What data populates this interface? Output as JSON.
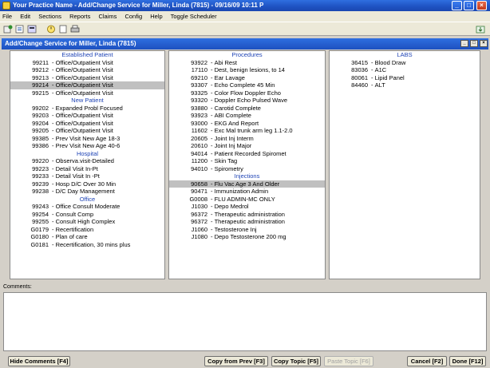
{
  "window": {
    "title": "Your Practice Name -  Add/Change Service for Miller, Linda (7815) - 09/16/09 10:11 P"
  },
  "menu": [
    "File",
    "Edit",
    "Sections",
    "Reports",
    "Claims",
    "Config",
    "Help",
    "Toggle Scheduler"
  ],
  "dialog": {
    "title": "Add/Change Service for Miller, Linda (7815)"
  },
  "left_panel": {
    "sections": [
      {
        "heading": "Established Patient",
        "items": [
          {
            "code": "99211",
            "desc": "Office/Outpatient Visit"
          },
          {
            "code": "99212",
            "desc": "Office/Outpatient Visit"
          },
          {
            "code": "99213",
            "desc": "Office/Outpatient Visit"
          },
          {
            "code": "99214",
            "desc": "Office/Outpatient Visit",
            "selected": true
          },
          {
            "code": "99215",
            "desc": "Office/Outpatient Visit"
          }
        ]
      },
      {
        "heading": "New Patient",
        "items": [
          {
            "code": "99202",
            "desc": "Expanded Probl Focused"
          },
          {
            "code": "99203",
            "desc": "Office/Outpatient Visit"
          },
          {
            "code": "99204",
            "desc": "Office/Outpatient Visit"
          },
          {
            "code": "99205",
            "desc": "Office/Outpatient Visit"
          },
          {
            "code": "99385",
            "desc": "Prev Visit New Age 18-3"
          },
          {
            "code": "99386",
            "desc": "Prev Visit New Age 40-6"
          }
        ]
      },
      {
        "heading": "Hospital",
        "items": [
          {
            "code": "99220",
            "desc": "Observa.visit-Detailed"
          },
          {
            "code": "99223",
            "desc": "Detail Visit In-Pt"
          },
          {
            "code": "99233",
            "desc": "Detail Visit In -Pt"
          },
          {
            "code": "99239",
            "desc": "Hosp D/C Over 30 Min"
          },
          {
            "code": "99238",
            "desc": "D/C Day Management"
          }
        ]
      },
      {
        "heading": "Office",
        "items": [
          {
            "code": "99243",
            "desc": "Office Consult Moderate"
          },
          {
            "code": "99254",
            "desc": "Consult Comp"
          },
          {
            "code": "99255",
            "desc": "Consult High Complex"
          },
          {
            "code": "G0179",
            "desc": "Recertification"
          },
          {
            "code": "G0180",
            "desc": "Plan of care"
          },
          {
            "code": "G0181",
            "desc": "Recertification, 30 mins plus"
          }
        ]
      }
    ]
  },
  "mid_panel": {
    "sections": [
      {
        "heading": "Procedures",
        "items": [
          {
            "code": "93922",
            "desc": "Abi Rest"
          },
          {
            "code": "17110",
            "desc": "Dest, benign lesions, to 14"
          },
          {
            "code": "69210",
            "desc": "Ear Lavage"
          },
          {
            "code": "93307",
            "desc": "Echo Complete 45 Min"
          },
          {
            "code": "93325",
            "desc": "Color Flow Doppler Echo"
          },
          {
            "code": "93320",
            "desc": "Doppler Echo Pulsed Wave"
          },
          {
            "code": "93880",
            "desc": "Carotid Complete"
          },
          {
            "code": "93923",
            "desc": "ABI Complete"
          },
          {
            "code": "93000",
            "desc": "EKG And Report"
          },
          {
            "code": "11602",
            "desc": "Exc Mal trunk arm leg 1.1-2.0"
          },
          {
            "code": "20605",
            "desc": "Joint Inj Interm"
          },
          {
            "code": "20610",
            "desc": "Joint Inj Major"
          },
          {
            "code": "94014",
            "desc": "Patient Recorded Spiromet"
          },
          {
            "code": "11200",
            "desc": "Skin Tag"
          },
          {
            "code": "94010",
            "desc": "Spirometry"
          }
        ]
      },
      {
        "heading": "Injections",
        "items": [
          {
            "code": "90658",
            "desc": "Flu Vac Age 3 And Older",
            "selected": true
          },
          {
            "code": "90471",
            "desc": "Immunization Admin"
          },
          {
            "code": "G0008",
            "desc": "FLU ADMIN-MC ONLY"
          },
          {
            "code": "J1030",
            "desc": "Depo Medrol"
          },
          {
            "code": "96372",
            "desc": "Therapeutic administration"
          },
          {
            "code": "96372",
            "desc": "Therapeutic administration"
          },
          {
            "code": "J1060",
            "desc": "Testosterone Inj"
          },
          {
            "code": "J1080",
            "desc": "Depo Testosterone 200 mg"
          }
        ]
      }
    ]
  },
  "right_panel": {
    "sections": [
      {
        "heading": "LABS",
        "items": [
          {
            "code": "36415",
            "desc": "Blood Draw"
          },
          {
            "code": "83036",
            "desc": "A1C"
          },
          {
            "code": "80061",
            "desc": "Lipid Panel"
          },
          {
            "code": "84460",
            "desc": "ALT"
          }
        ]
      }
    ]
  },
  "comments": {
    "label": "Comments:",
    "value": ""
  },
  "buttons": {
    "hide_comments": "Hide Comments [F4]",
    "copy_prev": "Copy from Prev [F3]",
    "copy_topic": "Copy Topic [F5]",
    "paste_topic": "Paste Topic [F6]",
    "cancel": "Cancel [F2]",
    "done": "Done [F12]"
  }
}
